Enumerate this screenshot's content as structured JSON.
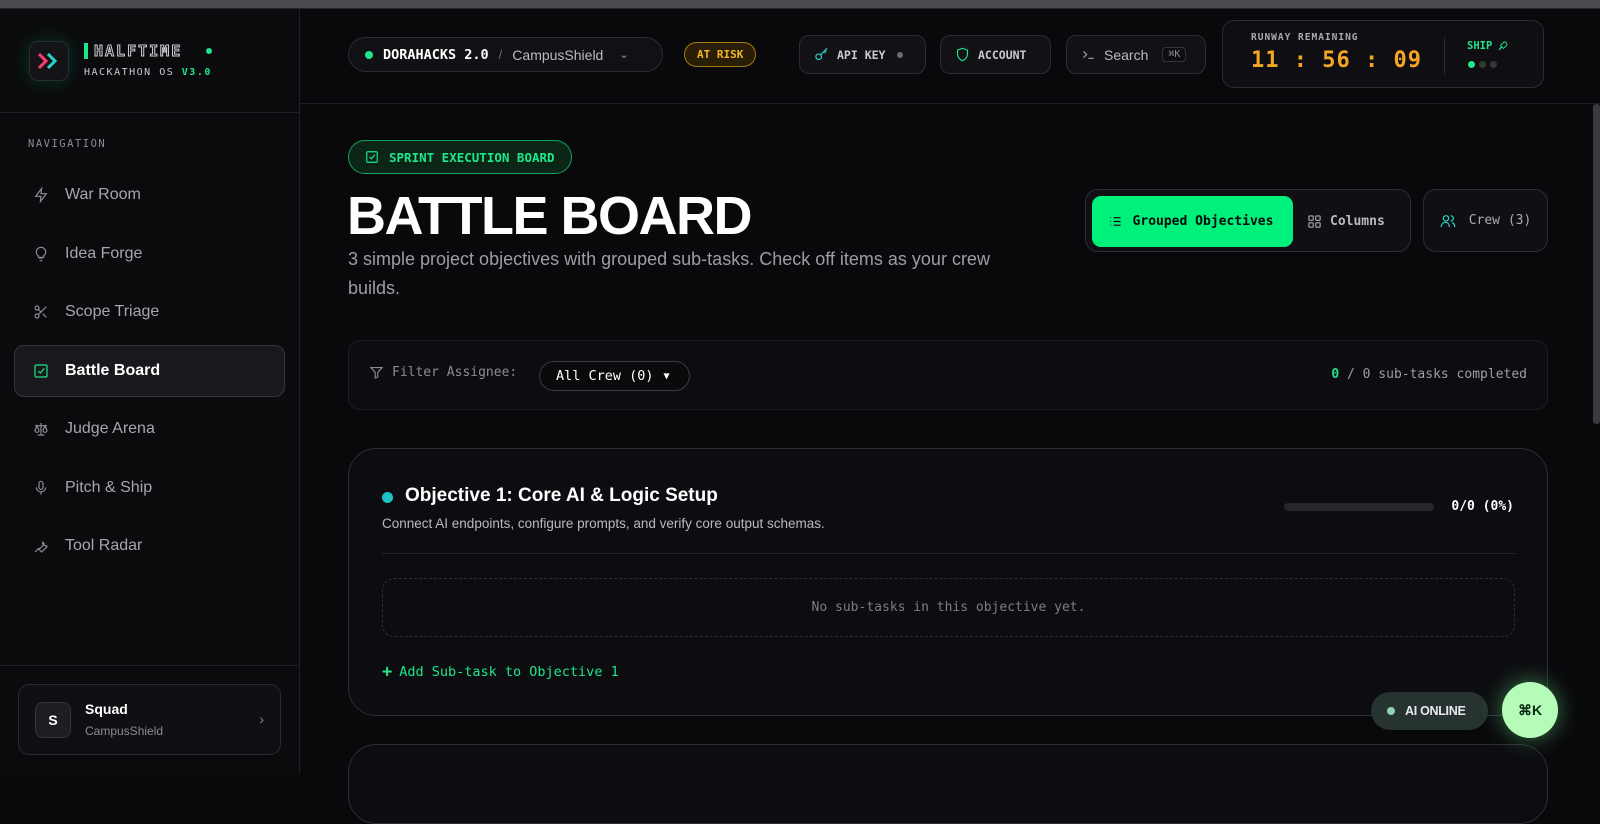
{
  "brand": {
    "name": "HALFTIME",
    "subtitle": "HACKATHON OS",
    "version": "V3.0"
  },
  "sidebar": {
    "heading": "NAVIGATION",
    "items": [
      {
        "label": "War Room",
        "icon": "bolt-icon"
      },
      {
        "label": "Idea Forge",
        "icon": "lightbulb-icon"
      },
      {
        "label": "Scope Triage",
        "icon": "scissors-icon"
      },
      {
        "label": "Battle Board",
        "icon": "checkbox-icon",
        "active": true
      },
      {
        "label": "Judge Arena",
        "icon": "scale-icon"
      },
      {
        "label": "Pitch & Ship",
        "icon": "microphone-icon"
      },
      {
        "label": "Tool Radar",
        "icon": "wrench-icon"
      }
    ],
    "squad": {
      "avatar": "S",
      "name": "Squad",
      "team": "CampusShield"
    }
  },
  "header": {
    "project": "DORAHACKS 2.0",
    "separator": "/",
    "subproject": "CampusShield",
    "status_badge": "AT RISK",
    "api_key_label": "API KEY",
    "account_label": "ACCOUNT",
    "search_label": "Search",
    "search_shortcut": "⌘K",
    "runway_label": "RUNWAY REMAINING",
    "runway_time": "11 : 56 : 09",
    "ship_label": "SHIP"
  },
  "main": {
    "tag": "SPRINT EXECUTION BOARD",
    "title": "BATTLE BOARD",
    "description": "3 simple project objectives with grouped sub-tasks. Check off items as your crew builds.",
    "view_grouped": "Grouped Objectives",
    "view_columns": "Columns",
    "crew_button": "Crew (3)",
    "filter_label": "Filter Assignee:",
    "filter_value": "All Crew (0)",
    "completed_count": "0",
    "completed_rest": " / 0 sub-tasks completed",
    "objectives": [
      {
        "title": "Objective 1: Core AI & Logic Setup",
        "description": "Connect AI endpoints, configure prompts, and verify core output schemas.",
        "progress_label": "0/0 (0%)",
        "progress": 0,
        "empty_text": "No sub-tasks in this objective yet.",
        "add_label": "Add Sub-task to Objective 1"
      }
    ]
  },
  "floating": {
    "ai_status": "AI ONLINE",
    "command_button": "⌘K"
  },
  "colors": {
    "accent": "#1ee68a",
    "warning": "#f5a524",
    "teal": "#19c3c6"
  }
}
